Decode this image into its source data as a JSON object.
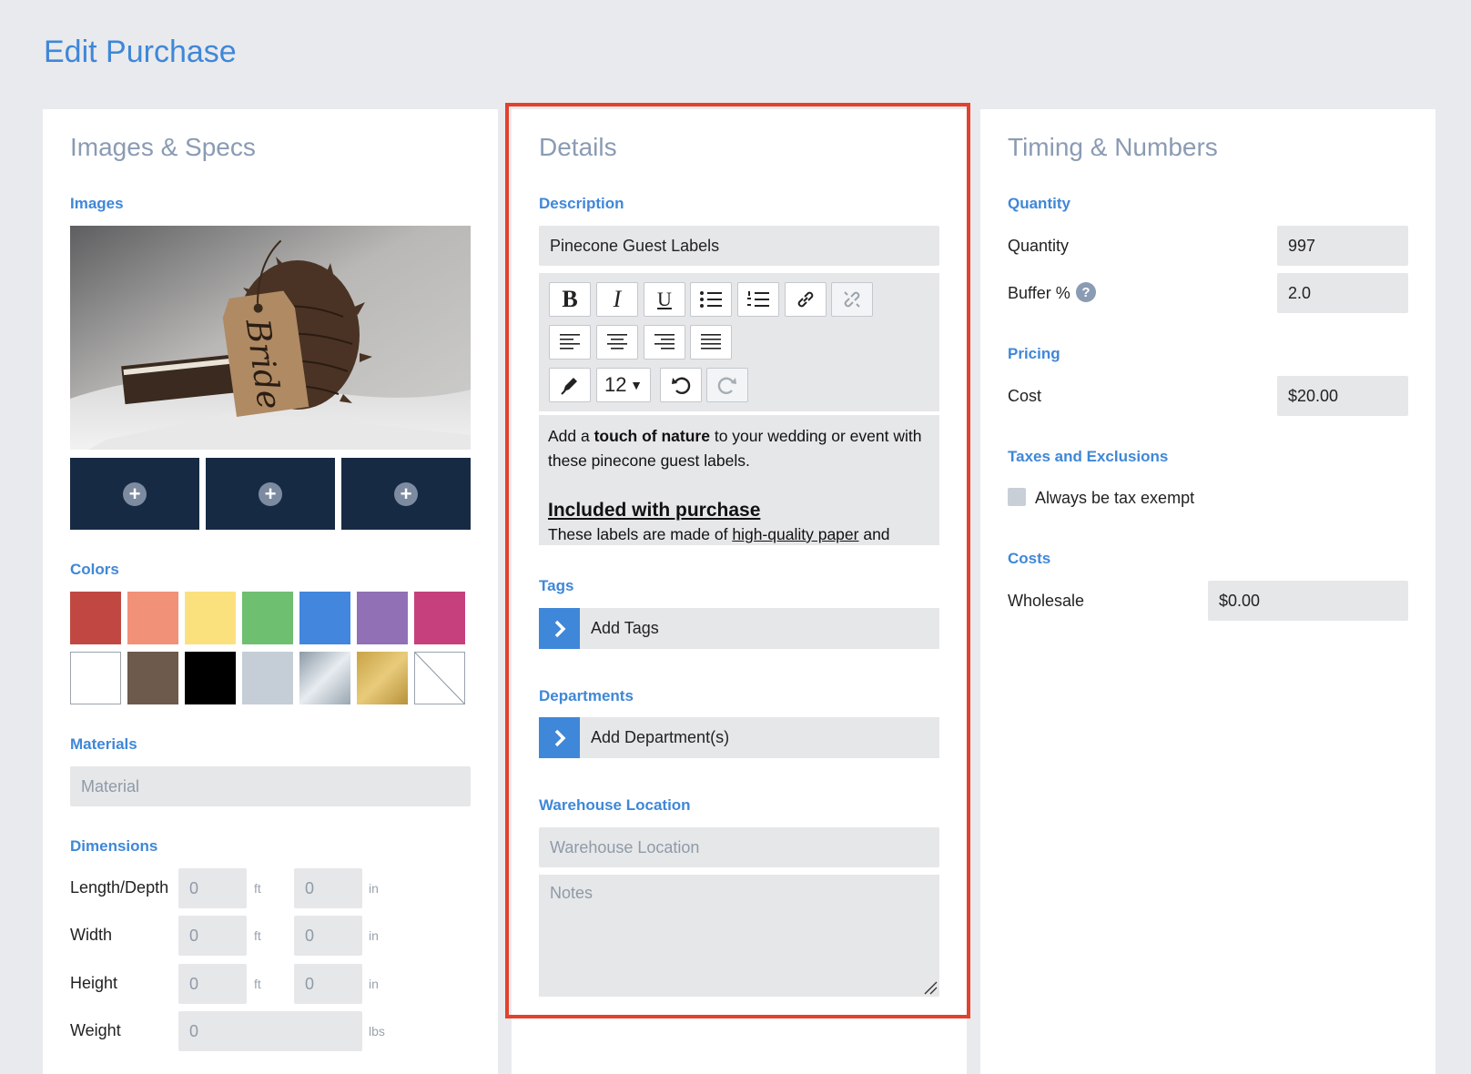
{
  "page": {
    "title": "Edit Purchase"
  },
  "left": {
    "title": "Images & Specs",
    "images_label": "Images",
    "colors_label": "Colors",
    "colors": [
      "#c14842",
      "#f19178",
      "#fbe17e",
      "#6fbf71",
      "#4287dd",
      "#9170b6",
      "#c6407e",
      "#ffffff",
      "#6d5a4d",
      "#000000",
      "#c5ced7",
      "silver-gradient",
      "gold-gradient",
      "none"
    ],
    "materials_label": "Materials",
    "material_placeholder": "Material",
    "dimensions_label": "Dimensions",
    "dimensions": [
      {
        "label": "Length/Depth",
        "ft": "0",
        "in": "0"
      },
      {
        "label": "Width",
        "ft": "0",
        "in": "0"
      },
      {
        "label": "Height",
        "ft": "0",
        "in": "0"
      }
    ],
    "unit_ft": "ft",
    "unit_in": "in",
    "weight_label": "Weight",
    "weight_value": "0",
    "unit_lbs": "lbs",
    "image_tag_text": "Bride"
  },
  "details": {
    "title": "Details",
    "description_label": "Description",
    "description_value": "Pinecone Guest Labels",
    "font_size": "12",
    "body": {
      "p1_pre": "Add a ",
      "p1_bold": "touch of nature",
      "p1_post": " to your wedding or event with these pinecone guest labels.",
      "heading": "Included with purchase",
      "p2_pre": "These labels are made of ",
      "p2_link": "high-quality paper",
      "p2_post": "  and"
    },
    "tags_label": "Tags",
    "tags_button": "Add Tags",
    "departments_label": "Departments",
    "departments_button": "Add Department(s)",
    "warehouse_label": "Warehouse Location",
    "warehouse_placeholder": "Warehouse Location",
    "notes_placeholder": "Notes"
  },
  "timing": {
    "title": "Timing & Numbers",
    "quantity_label": "Quantity",
    "quantity_row": "Quantity",
    "quantity_value": "997",
    "buffer_row": "Buffer %",
    "buffer_value": "2.0",
    "help_glyph": "?",
    "pricing_label": "Pricing",
    "cost_row": "Cost",
    "cost_value": "$20.00",
    "taxes_label": "Taxes and Exclusions",
    "tax_exempt_label": "Always be tax exempt",
    "costs_label": "Costs",
    "wholesale_row": "Wholesale",
    "wholesale_value": "$0.00"
  }
}
